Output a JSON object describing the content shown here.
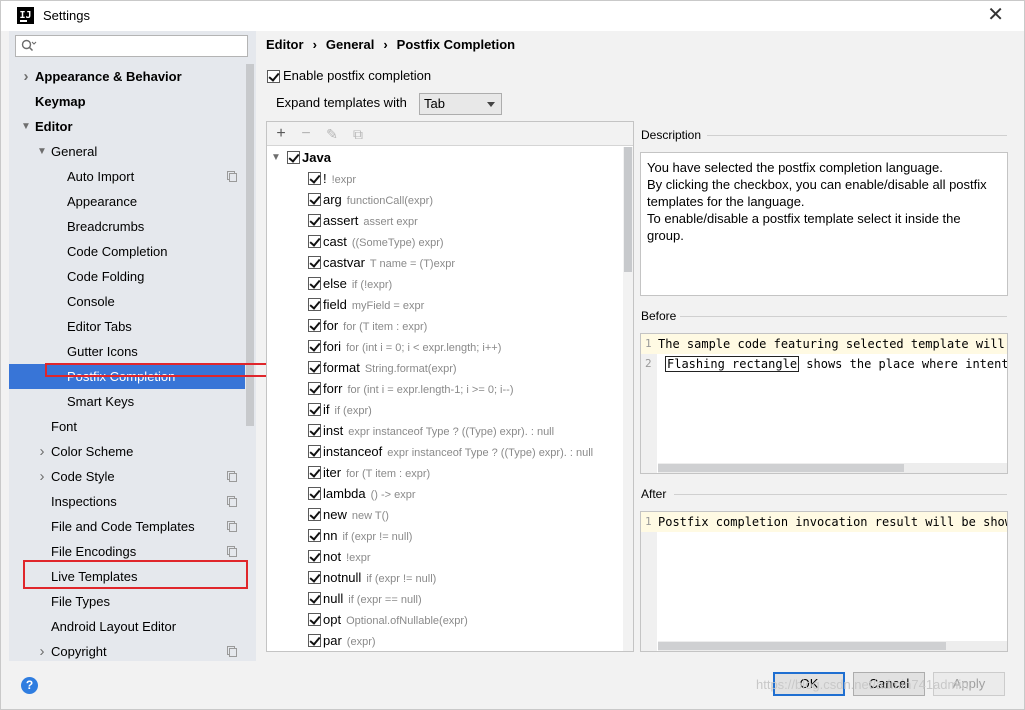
{
  "window": {
    "title": "Settings",
    "logo": "IJ"
  },
  "search": {
    "placeholder": "",
    "value": ""
  },
  "sidebar": {
    "items": [
      {
        "label": "Appearance & Behavior",
        "level": 0,
        "bold": true,
        "arrow": "right",
        "copy": false
      },
      {
        "label": "Keymap",
        "level": 0,
        "bold": true,
        "arrow": "",
        "copy": false
      },
      {
        "label": "Editor",
        "level": 0,
        "bold": true,
        "arrow": "down",
        "copy": false
      },
      {
        "label": "General",
        "level": 1,
        "bold": false,
        "arrow": "down",
        "copy": false
      },
      {
        "label": "Auto Import",
        "level": 2,
        "bold": false,
        "arrow": "",
        "copy": true
      },
      {
        "label": "Appearance",
        "level": 2,
        "bold": false,
        "arrow": "",
        "copy": false
      },
      {
        "label": "Breadcrumbs",
        "level": 2,
        "bold": false,
        "arrow": "",
        "copy": false
      },
      {
        "label": "Code Completion",
        "level": 2,
        "bold": false,
        "arrow": "",
        "copy": false
      },
      {
        "label": "Code Folding",
        "level": 2,
        "bold": false,
        "arrow": "",
        "copy": false
      },
      {
        "label": "Console",
        "level": 2,
        "bold": false,
        "arrow": "",
        "copy": false
      },
      {
        "label": "Editor Tabs",
        "level": 2,
        "bold": false,
        "arrow": "",
        "copy": false
      },
      {
        "label": "Gutter Icons",
        "level": 2,
        "bold": false,
        "arrow": "",
        "copy": false
      },
      {
        "label": "Postfix Completion",
        "level": 2,
        "bold": false,
        "arrow": "",
        "copy": false,
        "selected": true
      },
      {
        "label": "Smart Keys",
        "level": 2,
        "bold": false,
        "arrow": "",
        "copy": false
      },
      {
        "label": "Font",
        "level": 1,
        "bold": false,
        "arrow": "",
        "copy": false
      },
      {
        "label": "Color Scheme",
        "level": 1,
        "bold": false,
        "arrow": "right",
        "copy": false
      },
      {
        "label": "Code Style",
        "level": 1,
        "bold": false,
        "arrow": "right",
        "copy": true
      },
      {
        "label": "Inspections",
        "level": 1,
        "bold": false,
        "arrow": "",
        "copy": true
      },
      {
        "label": "File and Code Templates",
        "level": 1,
        "bold": false,
        "arrow": "",
        "copy": true
      },
      {
        "label": "File Encodings",
        "level": 1,
        "bold": false,
        "arrow": "",
        "copy": true
      },
      {
        "label": "Live Templates",
        "level": 1,
        "bold": false,
        "arrow": "",
        "copy": false
      },
      {
        "label": "File Types",
        "level": 1,
        "bold": false,
        "arrow": "",
        "copy": false
      },
      {
        "label": "Android Layout Editor",
        "level": 1,
        "bold": false,
        "arrow": "",
        "copy": false
      },
      {
        "label": "Copyright",
        "level": 1,
        "bold": false,
        "arrow": "right",
        "copy": true
      }
    ]
  },
  "breadcrumb": [
    "Editor",
    "General",
    "Postfix Completion"
  ],
  "enable": {
    "label": "Enable postfix completion",
    "checked": true
  },
  "expand": {
    "label": "Expand templates with",
    "value": "Tab"
  },
  "toolbar": {
    "add": "+",
    "remove": "−",
    "edit": "✎",
    "copy": "⧉"
  },
  "templates": {
    "group": "Java",
    "items": [
      {
        "key": "!",
        "desc": "!expr"
      },
      {
        "key": "arg",
        "desc": "functionCall(expr)"
      },
      {
        "key": "assert",
        "desc": "assert expr"
      },
      {
        "key": "cast",
        "desc": "((SomeType) expr)"
      },
      {
        "key": "castvar",
        "desc": "T name = (T)expr"
      },
      {
        "key": "else",
        "desc": "if (!expr)"
      },
      {
        "key": "field",
        "desc": "myField = expr"
      },
      {
        "key": "for",
        "desc": "for (T item : expr)"
      },
      {
        "key": "fori",
        "desc": "for (int i = 0; i < expr.length; i++)"
      },
      {
        "key": "format",
        "desc": "String.format(expr)"
      },
      {
        "key": "forr",
        "desc": "for (int i = expr.length-1; i >= 0; i--)"
      },
      {
        "key": "if",
        "desc": "if (expr)"
      },
      {
        "key": "inst",
        "desc": "expr instanceof Type ? ((Type) expr). : null"
      },
      {
        "key": "instanceof",
        "desc": "expr instanceof Type ? ((Type) expr). : null"
      },
      {
        "key": "iter",
        "desc": "for (T item : expr)"
      },
      {
        "key": "lambda",
        "desc": "() -> expr"
      },
      {
        "key": "new",
        "desc": "new T()"
      },
      {
        "key": "nn",
        "desc": "if (expr != null)"
      },
      {
        "key": "not",
        "desc": "!expr"
      },
      {
        "key": "notnull",
        "desc": "if (expr != null)"
      },
      {
        "key": "null",
        "desc": "if (expr == null)"
      },
      {
        "key": "opt",
        "desc": "Optional.ofNullable(expr)"
      },
      {
        "key": "par",
        "desc": "(expr)"
      }
    ]
  },
  "description": {
    "title": "Description",
    "lines": [
      "You have selected the postfix completion language.",
      "By clicking the checkbox, you can enable/disable all postfix",
      "templates for the language.",
      "To enable/disable a postfix template select it inside the",
      "group."
    ]
  },
  "before": {
    "title": "Before",
    "line1_num": "1",
    "line1": "The sample code featuring selected template will b",
    "line2_num": "2",
    "line2_flash": "Flashing rectangle",
    "line2_rest": " shows the place where intentio"
  },
  "after": {
    "title": "After",
    "line1_num": "1",
    "line1": "Postfix completion invocation result will be shown"
  },
  "buttons": {
    "ok": "OK",
    "cancel": "Cancel",
    "apply": "Apply",
    "help": "?"
  },
  "watermark": "https://blog.csdn.net/admin741admin",
  "colors": {
    "selection": "#3875d7",
    "highlight": "#e0262b",
    "help": "#2f7de0"
  }
}
